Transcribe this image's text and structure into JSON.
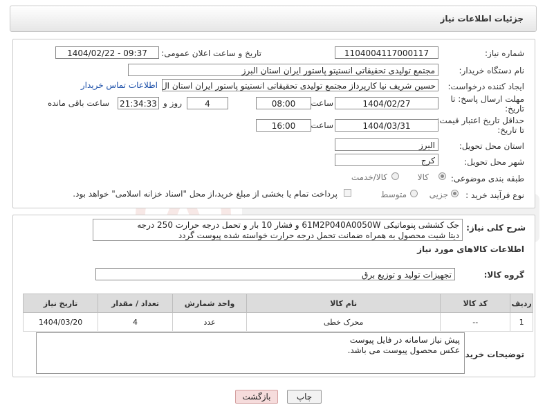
{
  "header": {
    "title": "جزئیات اطلاعات نیاز"
  },
  "form": {
    "need_number_label": "شماره نیاز:",
    "need_number": "1104004117000117",
    "announce_label": "تاریخ و ساعت اعلان عمومی:",
    "announce_value": "1404/02/22 - 09:37",
    "buyer_org_label": "نام دستگاه خریدار:",
    "buyer_org": "مجتمع تولیدی تحقیقاتی انستیتو پاستور ایران استان البرز",
    "requester_label": "ایجاد کننده درخواست:",
    "requester": "حسین شریف نیا کارپرداز مجتمع تولیدی تحقیقاتی انستیتو پاستور ایران استان ال",
    "contact_link": "اطلاعات تماس خریدار",
    "deadline_label_1": "مهلت ارسال پاسخ: تا",
    "deadline_label_2": "تاریخ:",
    "deadline_date": "1404/02/27",
    "time_label": "ساعت",
    "deadline_time": "08:00",
    "days_value": "4",
    "days_label": "روز و",
    "remaining_time": "21:34:33",
    "remaining_label": "ساعت باقی مانده",
    "price_label_1": "حداقل تاریخ اعتبار قیمت:",
    "price_label_2": "تا تاریخ:",
    "price_date": "1404/03/31",
    "price_time": "16:00",
    "province_label": "استان محل تحویل:",
    "province": "البرز",
    "city_label": "شهر محل تحویل:",
    "city": "کرج",
    "category_label": "طبقه بندی موضوعی:",
    "category_options": [
      "کالا",
      "کالا/خدمت"
    ],
    "process_label": "نوع فرآیند خرید :",
    "process_options": [
      "جزیی",
      "متوسط"
    ],
    "payment_note": "پرداخت تمام یا بخشی از مبلغ خرید،از محل \"اسناد خزانه اسلامی\" خواهد بود."
  },
  "description": {
    "label": "شرح کلی نیاز:",
    "line1": "جک کششی پنوماتیکی 61M2P040A0050W و فشار 10 بار و تحمل درجه حرارت 250 درجه",
    "line2": "دیتا شیت محصول به همراه ضمانت تحمل درجه حرارت خواسته شده پیوست گردد"
  },
  "goods": {
    "section_title": "اطلاعات کالاهای مورد نیاز",
    "group_label": "گروه کالا:",
    "group_value": "تجهیزات تولید و توزیع برق",
    "columns": [
      "ردیف",
      "کد کالا",
      "نام کالا",
      "واحد شمارش",
      "تعداد / مقدار",
      "تاریخ نیاز"
    ],
    "rows": [
      [
        "1",
        "--",
        "محرک خطی",
        "عدد",
        "4",
        "1404/03/20"
      ]
    ]
  },
  "buyer_notes": {
    "label": "توضیحات خریدار:",
    "line1": "پیش نیاز سامانه در فایل پیوست",
    "line2": "عکس محصول پیوست می باشد."
  },
  "buttons": {
    "print": "چاپ",
    "back": "بازگشت"
  },
  "colors": {
    "link": "#1a4ea8",
    "back_button_bg": "#f6dcdc"
  }
}
